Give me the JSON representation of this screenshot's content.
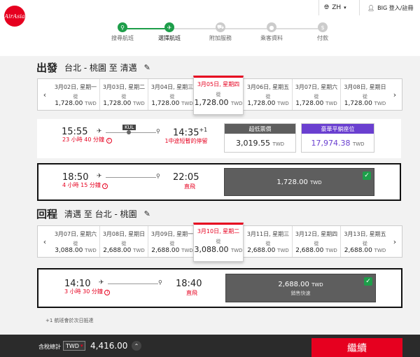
{
  "brand": {
    "logo_text": "AirAsia",
    "accent": "#e6001f",
    "selected_step": "#1e9e4a",
    "fare_premium": "#6a3fd0"
  },
  "header": {
    "lang": "ZH",
    "user": "BIG 登入/註冊",
    "steps": [
      {
        "label": "搜尋航班",
        "icon": "search-icon",
        "state": "done"
      },
      {
        "label": "選擇航班",
        "icon": "plane-icon",
        "state": "current"
      },
      {
        "label": "附加服務",
        "icon": "cart-icon",
        "state": "todo"
      },
      {
        "label": "乘客資料",
        "icon": "person-icon",
        "state": "todo"
      },
      {
        "label": "付款",
        "icon": "dollar-icon",
        "state": "todo"
      }
    ]
  },
  "outbound": {
    "title": "出發",
    "route": "台北 - 桃園 至 清邁",
    "dates": [
      {
        "date": "3月02日, 星期一",
        "from": "從",
        "price": "1,728.00",
        "cur": "TWD"
      },
      {
        "date": "3月03日, 星期二",
        "from": "從",
        "price": "1,728.00",
        "cur": "TWD"
      },
      {
        "date": "3月04日, 星期三",
        "from": "從",
        "price": "1,728.00",
        "cur": "TWD"
      },
      {
        "date": "3月05日, 星期四",
        "from": "從",
        "price": "1,728.00",
        "cur": "TWD",
        "selected": true
      },
      {
        "date": "3月06日, 星期五",
        "from": "從",
        "price": "1,728.00",
        "cur": "TWD"
      },
      {
        "date": "3月07日, 星期六",
        "from": "從",
        "price": "1,728.00",
        "cur": "TWD"
      },
      {
        "date": "3月08日, 星期日",
        "from": "從",
        "price": "1,728.00",
        "cur": "TWD"
      }
    ],
    "flights": [
      {
        "depart": "15:55",
        "arrive": "14:35",
        "day_offset": "+1",
        "duration": "23 小時 40 分鐘",
        "stop_code": "KUL",
        "stop_note": "1中途短暫的停留",
        "fares": [
          {
            "name": "超低票價",
            "price": "3,019.55",
            "cur": "TWD"
          },
          {
            "name": "豪華平躺座位",
            "price": "17,974.38",
            "cur": "TWD"
          }
        ]
      },
      {
        "depart": "18:50",
        "arrive": "22:05",
        "duration": "4 小時 15 分鐘",
        "stop_note": "直飛",
        "selected_fare": {
          "price": "1,728.00",
          "cur": "TWD"
        }
      }
    ]
  },
  "return": {
    "title": "回程",
    "route": "清邁 至 台北 - 桃園",
    "dates": [
      {
        "date": "3月07日, 星期六",
        "from": "從",
        "price": "3,088.00",
        "cur": "TWD"
      },
      {
        "date": "3月08日, 星期日",
        "from": "從",
        "price": "2,688.00",
        "cur": "TWD"
      },
      {
        "date": "3月09日, 星期一",
        "from": "從",
        "price": "2,688.00",
        "cur": "TWD"
      },
      {
        "date": "3月10日, 星期二",
        "from": "從",
        "price": "3,088.00",
        "cur": "TWD",
        "selected": true
      },
      {
        "date": "3月11日, 星期三",
        "from": "從",
        "price": "2,688.00",
        "cur": "TWD"
      },
      {
        "date": "3月12日, 星期四",
        "from": "從",
        "price": "2,688.00",
        "cur": "TWD"
      },
      {
        "date": "3月13日, 星期五",
        "from": "從",
        "price": "2,688.00",
        "cur": "TWD"
      }
    ],
    "flights": [
      {
        "depart": "14:10",
        "arrive": "18:40",
        "duration": "3 小時 30 分鐘",
        "stop_note": "直飛",
        "selected_fare": {
          "price": "2,688.00",
          "cur": "TWD",
          "sub": "銷售快速"
        }
      }
    ]
  },
  "footnote": "+1 航班會於次日抵達",
  "footer": {
    "total_label": "含稅總計",
    "currency": "TWD",
    "total": "4,416.00",
    "continue": "繼續"
  }
}
